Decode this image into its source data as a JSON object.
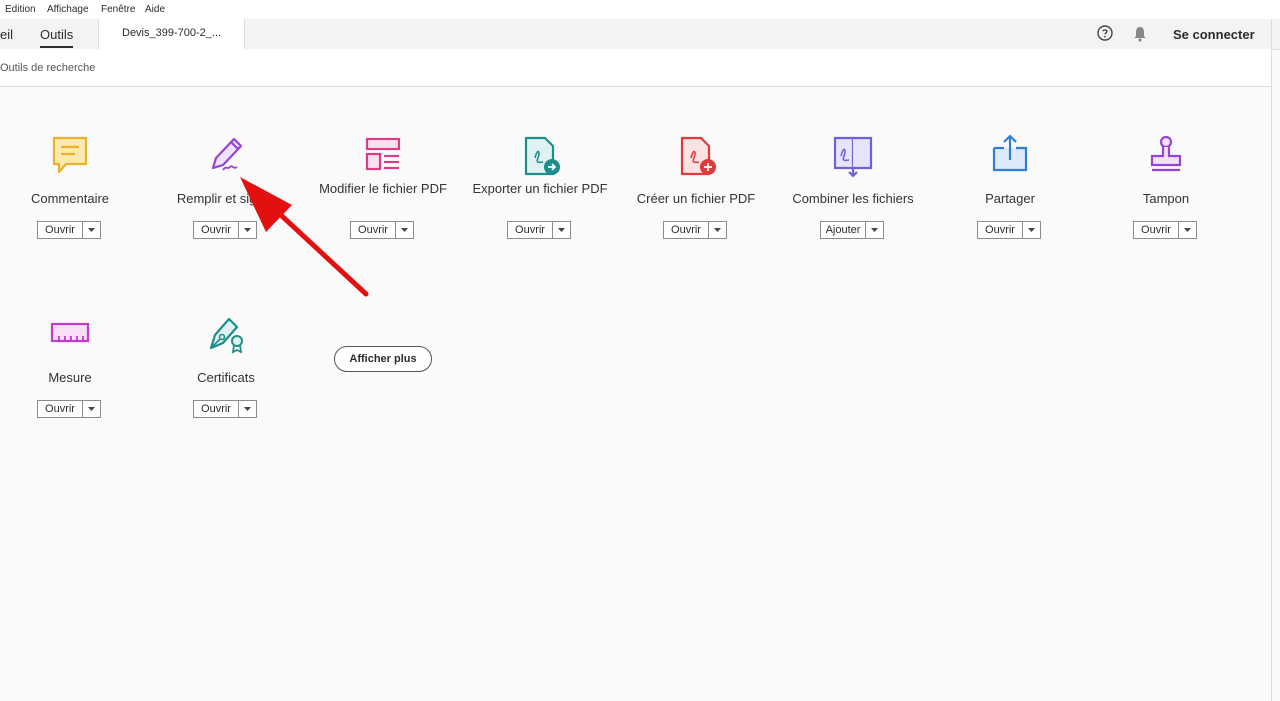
{
  "menu": [
    "Edition",
    "Affichage",
    "Fenêtre",
    "Aide"
  ],
  "tabs": {
    "home": "eil",
    "tools": "Outils",
    "document": "Devis_399-700-2_..."
  },
  "header": {
    "signin": "Se connecter"
  },
  "search": {
    "label": "Outils de recherche"
  },
  "tools": [
    {
      "name": "Commentaire",
      "action": "Ouvrir",
      "icon": "comment-icon",
      "color": "#e8b32a"
    },
    {
      "name": "Remplir et signer",
      "action": "Ouvrir",
      "icon": "fill-sign-icon",
      "color": "#9545d6"
    },
    {
      "name": "Modifier le fichier PDF",
      "action": "Ouvrir",
      "icon": "edit-pdf-icon",
      "color": "#d93d8a"
    },
    {
      "name": "Exporter un fichier PDF",
      "action": "Ouvrir",
      "icon": "export-pdf-icon",
      "color": "#1c8f8a"
    },
    {
      "name": "Créer un fichier PDF",
      "action": "Ouvrir",
      "icon": "create-pdf-icon",
      "color": "#e03b3b"
    },
    {
      "name": "Combiner les fichiers",
      "action": "Ajouter",
      "icon": "combine-files-icon",
      "color": "#6b63d9"
    },
    {
      "name": "Partager",
      "action": "Ouvrir",
      "icon": "share-icon",
      "color": "#2f7fd9"
    },
    {
      "name": "Tampon",
      "action": "Ouvrir",
      "icon": "stamp-icon",
      "color": "#9545d6"
    },
    {
      "name": "Mesure",
      "action": "Ouvrir",
      "icon": "measure-icon",
      "color": "#c23ad0"
    },
    {
      "name": "Certificats",
      "action": "Ouvrir",
      "icon": "certificate-icon",
      "color": "#1c8f8a"
    }
  ],
  "more_label": "Afficher plus",
  "annotation_color": "#e31010"
}
